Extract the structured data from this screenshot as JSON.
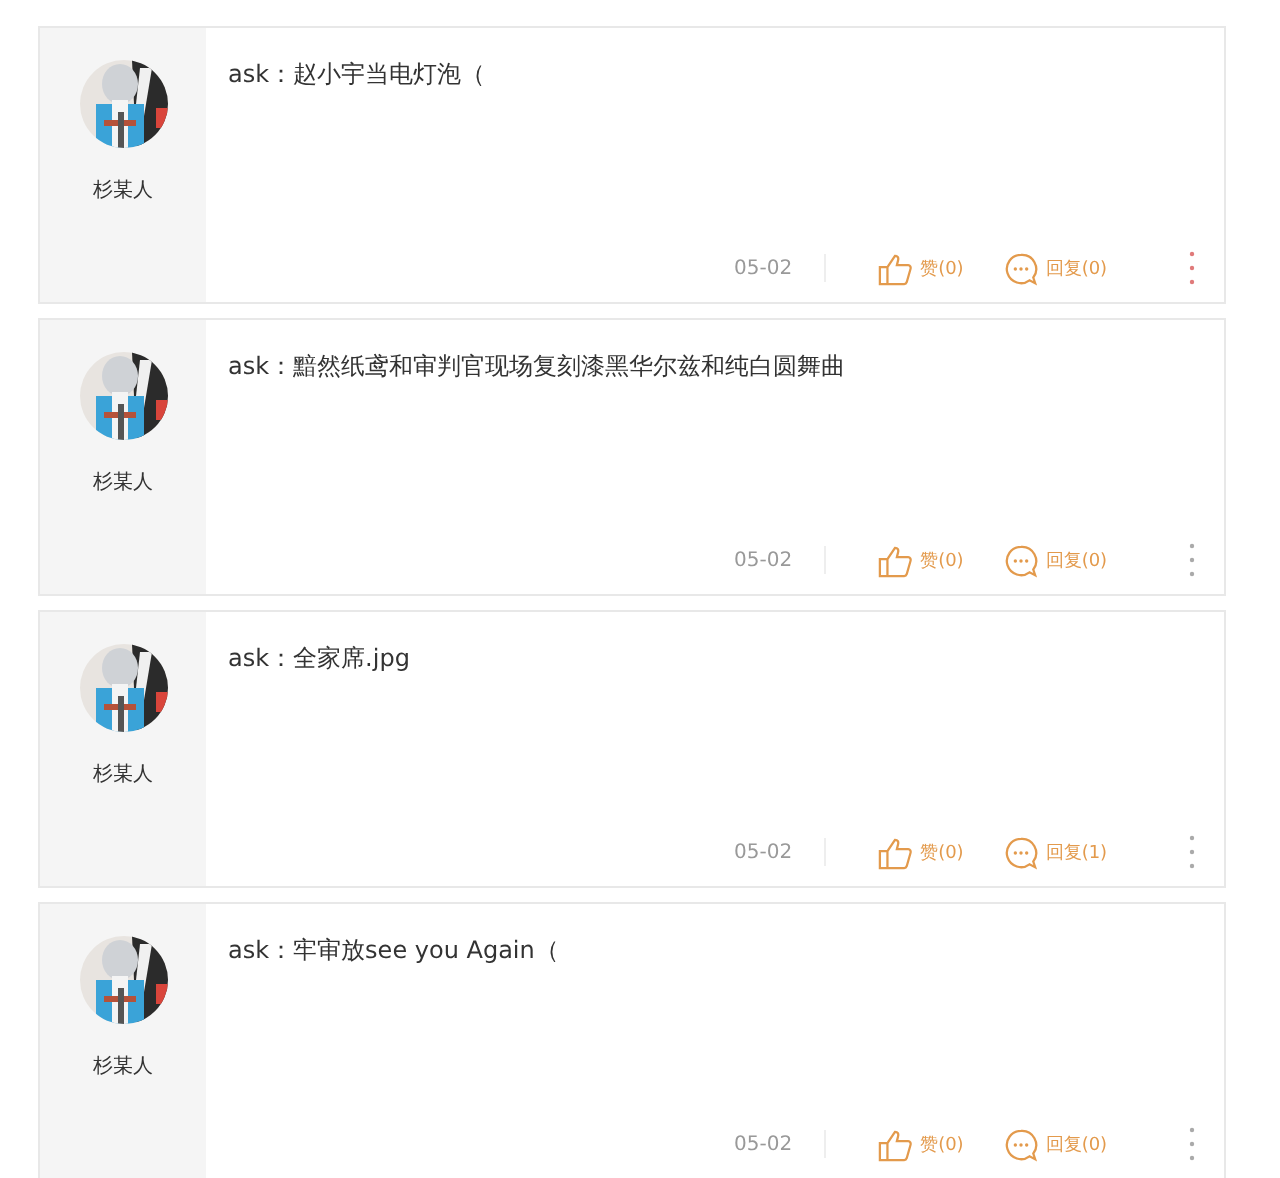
{
  "comments": [
    {
      "user": "杉某人",
      "text": "ask：赵小宇当电灯泡（",
      "date": "05-02",
      "like": "赞(0)",
      "reply": "回复(0)",
      "more": {
        "highlighted": true
      }
    },
    {
      "user": "杉某人",
      "text": "ask：黯然纸鸢和审判官现场复刻漆黑华尔兹和纯白圆舞曲",
      "date": "05-02",
      "like": "赞(0)",
      "reply": "回复(0)",
      "more": {
        "highlighted": false
      }
    },
    {
      "user": "杉某人",
      "text": "ask：全家席.jpg",
      "date": "05-02",
      "like": "赞(0)",
      "reply": "回复(1)",
      "more": {
        "highlighted": false
      }
    },
    {
      "user": "杉某人",
      "text": "ask：牢审放see you Again（",
      "date": "05-02",
      "like": "赞(0)",
      "reply": "回复(0)",
      "more": {
        "highlighted": false
      }
    }
  ]
}
